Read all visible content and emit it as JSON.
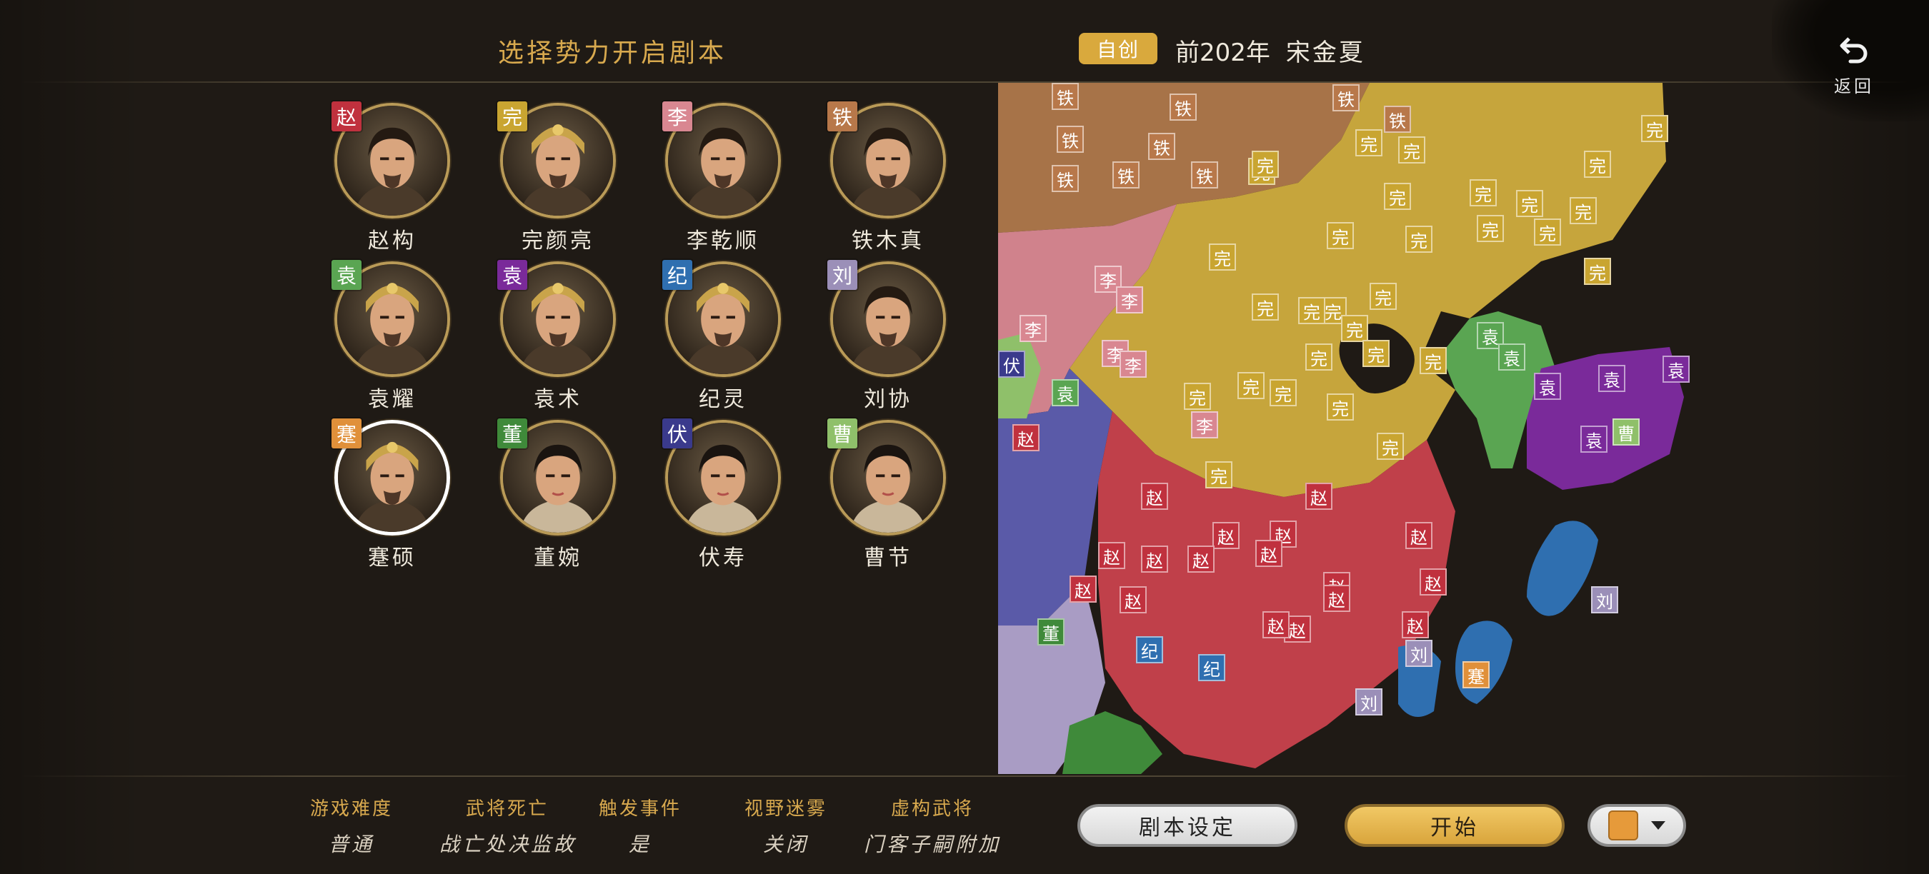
{
  "header": {
    "title": "选择势力开启剧本",
    "badge_custom": "自创",
    "era_prefix": "前",
    "era_year": "202",
    "era_suffix": "年",
    "dynasties": "宋金夏",
    "back_label": "返回"
  },
  "characters": [
    {
      "name": "赵构",
      "tag": "赵",
      "color": "#c0313e"
    },
    {
      "name": "完颜亮",
      "tag": "完",
      "color": "#c9a531"
    },
    {
      "name": "李乾顺",
      "tag": "李",
      "color": "#d98791"
    },
    {
      "name": "铁木真",
      "tag": "铁",
      "color": "#b8784a"
    },
    {
      "name": "袁耀",
      "tag": "袁",
      "color": "#5aa552"
    },
    {
      "name": "袁术",
      "tag": "袁",
      "color": "#7a2a9a"
    },
    {
      "name": "纪灵",
      "tag": "纪",
      "color": "#2f6fb0"
    },
    {
      "name": "刘协",
      "tag": "刘",
      "color": "#9b8fb8"
    },
    {
      "name": "蹇硕",
      "tag": "蹇",
      "color": "#e0903a"
    },
    {
      "name": "董婉",
      "tag": "董",
      "color": "#3f8a3a"
    },
    {
      "name": "伏寿",
      "tag": "伏",
      "color": "#3a3a8c"
    },
    {
      "name": "曹节",
      "tag": "曹",
      "color": "#8fc06a"
    }
  ],
  "selected_character": "蹇硕",
  "map": {
    "markers": [
      {
        "t": "铁",
        "c": "#b8784a"
      },
      {
        "t": "铁",
        "c": "#b8784a"
      },
      {
        "t": "铁",
        "c": "#b8784a"
      },
      {
        "t": "铁",
        "c": "#b8784a"
      },
      {
        "t": "铁",
        "c": "#b8784a"
      },
      {
        "t": "铁",
        "c": "#b8784a"
      },
      {
        "t": "铁",
        "c": "#b8784a"
      },
      {
        "t": "铁",
        "c": "#b8784a"
      },
      {
        "t": "铁",
        "c": "#b8784a"
      },
      {
        "t": "完",
        "c": "#c9a531"
      },
      {
        "t": "完",
        "c": "#c9a531"
      },
      {
        "t": "完",
        "c": "#c9a531"
      },
      {
        "t": "完",
        "c": "#c9a531"
      },
      {
        "t": "完",
        "c": "#c9a531"
      },
      {
        "t": "完",
        "c": "#c9a531"
      },
      {
        "t": "完",
        "c": "#c9a531"
      },
      {
        "t": "完",
        "c": "#c9a531"
      },
      {
        "t": "完",
        "c": "#c9a531"
      },
      {
        "t": "完",
        "c": "#c9a531"
      },
      {
        "t": "完",
        "c": "#c9a531"
      },
      {
        "t": "完",
        "c": "#c9a531"
      },
      {
        "t": "完",
        "c": "#c9a531"
      },
      {
        "t": "完",
        "c": "#c9a531"
      },
      {
        "t": "完",
        "c": "#c9a531"
      },
      {
        "t": "完",
        "c": "#c9a531"
      },
      {
        "t": "完",
        "c": "#c9a531"
      },
      {
        "t": "完",
        "c": "#c9a531"
      },
      {
        "t": "完",
        "c": "#c9a531"
      },
      {
        "t": "完",
        "c": "#c9a531"
      },
      {
        "t": "完",
        "c": "#c9a531"
      },
      {
        "t": "完",
        "c": "#c9a531"
      },
      {
        "t": "完",
        "c": "#c9a531"
      },
      {
        "t": "完",
        "c": "#c9a531"
      },
      {
        "t": "完",
        "c": "#c9a531"
      },
      {
        "t": "完",
        "c": "#c9a531"
      },
      {
        "t": "完",
        "c": "#c9a531"
      },
      {
        "t": "完",
        "c": "#c9a531"
      },
      {
        "t": "完",
        "c": "#c9a531"
      },
      {
        "t": "完",
        "c": "#c9a531"
      },
      {
        "t": "李",
        "c": "#d98791"
      },
      {
        "t": "李",
        "c": "#d98791"
      },
      {
        "t": "李",
        "c": "#d98791"
      },
      {
        "t": "李",
        "c": "#d98791"
      },
      {
        "t": "李",
        "c": "#d98791"
      },
      {
        "t": "李",
        "c": "#d98791"
      },
      {
        "t": "袁",
        "c": "#5aa552"
      },
      {
        "t": "袁",
        "c": "#5aa552"
      },
      {
        "t": "袁",
        "c": "#5aa552"
      },
      {
        "t": "袁",
        "c": "#7a2a9a"
      },
      {
        "t": "袁",
        "c": "#7a2a9a"
      },
      {
        "t": "袁",
        "c": "#7a2a9a"
      },
      {
        "t": "袁",
        "c": "#7a2a9a"
      },
      {
        "t": "曹",
        "c": "#8fc06a"
      },
      {
        "t": "伏",
        "c": "#3a3a8c"
      },
      {
        "t": "赵",
        "c": "#c0313e"
      },
      {
        "t": "赵",
        "c": "#c0313e"
      },
      {
        "t": "赵",
        "c": "#c0313e"
      },
      {
        "t": "赵",
        "c": "#c0313e"
      },
      {
        "t": "赵",
        "c": "#c0313e"
      },
      {
        "t": "赵",
        "c": "#c0313e"
      },
      {
        "t": "赵",
        "c": "#c0313e"
      },
      {
        "t": "赵",
        "c": "#c0313e"
      },
      {
        "t": "赵",
        "c": "#c0313e"
      },
      {
        "t": "赵",
        "c": "#c0313e"
      },
      {
        "t": "赵",
        "c": "#c0313e"
      },
      {
        "t": "赵",
        "c": "#c0313e"
      },
      {
        "t": "赵",
        "c": "#c0313e"
      },
      {
        "t": "赵",
        "c": "#c0313e"
      },
      {
        "t": "赵",
        "c": "#c0313e"
      },
      {
        "t": "赵",
        "c": "#c0313e"
      },
      {
        "t": "赵",
        "c": "#c0313e"
      },
      {
        "t": "赵",
        "c": "#c0313e"
      },
      {
        "t": "赵",
        "c": "#c0313e"
      },
      {
        "t": "纪",
        "c": "#2f6fb0"
      },
      {
        "t": "纪",
        "c": "#2f6fb0"
      },
      {
        "t": "刘",
        "c": "#9b8fb8"
      },
      {
        "t": "刘",
        "c": "#9b8fb8"
      },
      {
        "t": "刘",
        "c": "#9b8fb8"
      },
      {
        "t": "蹇",
        "c": "#e0903a"
      },
      {
        "t": "董",
        "c": "#3f8a3a"
      }
    ]
  },
  "options": [
    {
      "label": "游戏难度",
      "value": "普通"
    },
    {
      "label": "武将死亡",
      "value": "战亡处决监故"
    },
    {
      "label": "触发事件",
      "value": "是"
    },
    {
      "label": "视野迷雾",
      "value": "关闭"
    },
    {
      "label": "虚构武将",
      "value": "门客子嗣附加"
    }
  ],
  "buttons": {
    "scenario": "剧本设定",
    "start": "开始",
    "color_value": "#e69a3a"
  }
}
